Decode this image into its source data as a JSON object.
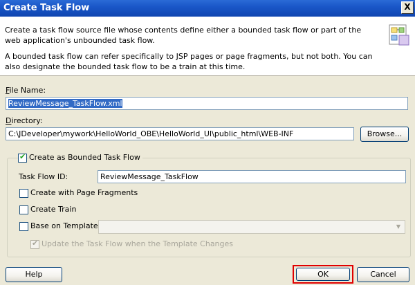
{
  "window": {
    "title": "Create Task Flow",
    "close_label": "X"
  },
  "header": {
    "p1": "Create a task flow source file whose contents define either a bounded task flow or part of the web application's unbounded task flow.",
    "p2": "A bounded task flow can refer specifically to JSP pages or page fragments, but not both.  You can also designate the bounded task flow to be a train at this time.",
    "icon": "task-flow-wizard-icon"
  },
  "file_name": {
    "label_u": "F",
    "label_rest": "ile Name:",
    "value": "ReviewMessage_TaskFlow.xml"
  },
  "directory": {
    "label_u": "D",
    "label_rest": "irectory:",
    "value": "C:\\JDeveloper\\mywork\\HelloWorld_OBE\\HelloWorld_UI\\public_html\\WEB-INF",
    "browse_label": "Browse..."
  },
  "bounded": {
    "label": "Create as Bounded Task Flow",
    "checked": true,
    "task_flow_id_label": "Task Flow ID:",
    "task_flow_id_value": "ReviewMessage_TaskFlow",
    "page_fragments_label": "Create with Page Fragments",
    "create_train_label": "Create Train",
    "base_template_label": "Base on Template:",
    "base_template_value": "",
    "update_label": "Update the Task Flow when the Template Changes"
  },
  "buttons": {
    "help": "Help",
    "ok": "OK",
    "cancel": "Cancel"
  },
  "colors": {
    "titlebar": "#0f45b0",
    "selection": "#316ac5",
    "highlight": "#e00000"
  }
}
